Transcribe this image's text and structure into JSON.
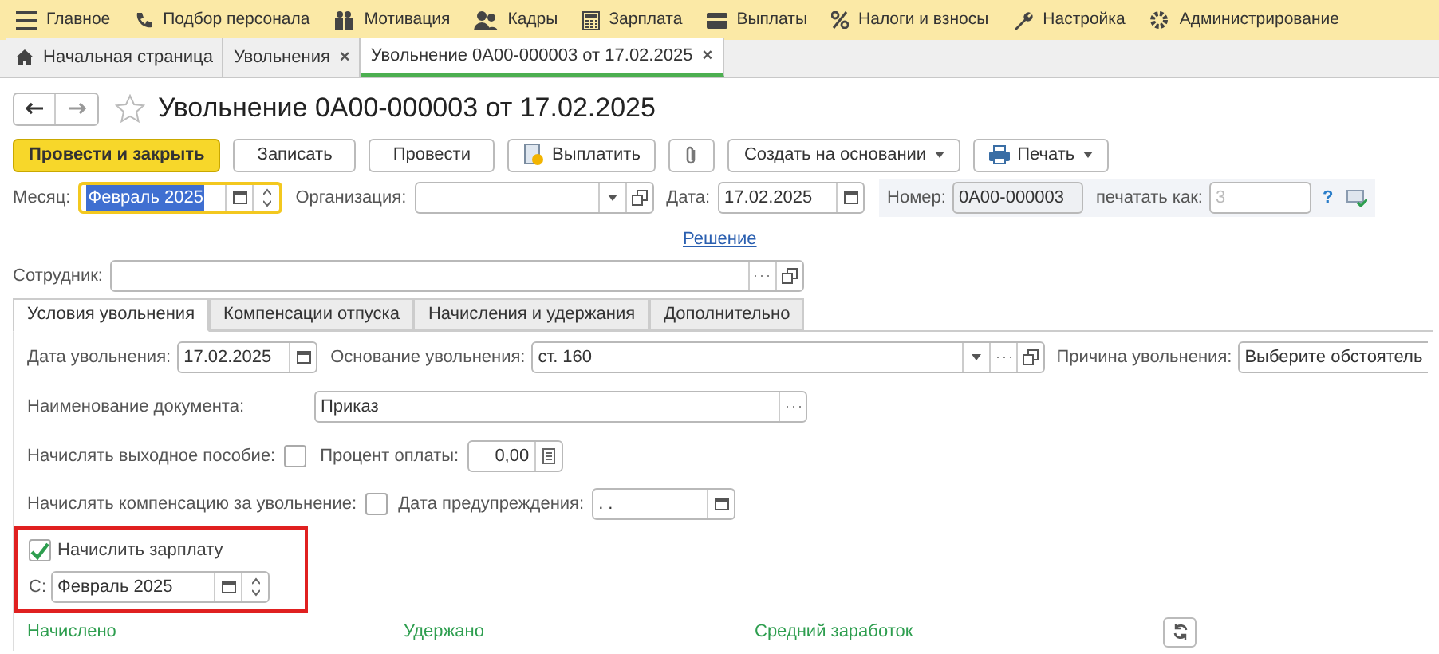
{
  "main_menu": [
    {
      "label": "Главное"
    },
    {
      "label": "Подбор персонала"
    },
    {
      "label": "Мотивация"
    },
    {
      "label": "Кадры"
    },
    {
      "label": "Зарплата"
    },
    {
      "label": "Выплаты"
    },
    {
      "label": "Налоги и взносы"
    },
    {
      "label": "Настройка"
    },
    {
      "label": "Администрирование"
    }
  ],
  "open_tabs": [
    {
      "label": "Начальная страница",
      "selected": false
    },
    {
      "label": "Увольнения",
      "selected": false,
      "close": "×"
    },
    {
      "label": "Увольнение 0A00-000003 от 17.02.2025",
      "selected": true,
      "close": "×"
    }
  ],
  "document": {
    "title": "Увольнение 0A00-000003 от 17.02.2025"
  },
  "toolbar": [
    {
      "kind": "primary",
      "label": "Провести и закрыть"
    },
    {
      "kind": "plain",
      "label": "Записать"
    },
    {
      "kind": "plain",
      "label": "Провести"
    },
    {
      "kind": "pay",
      "label": "Выплатить"
    },
    {
      "kind": "attach"
    },
    {
      "kind": "dropdown",
      "label": "Создать на основании"
    },
    {
      "kind": "print",
      "label": "Печать"
    }
  ],
  "header": {
    "month": {
      "label": "Месяц:",
      "value": "Февраль 2025",
      "focused": true
    },
    "organization": {
      "label": "Организация:"
    },
    "date": {
      "label": "Дата:",
      "value": "17.02.2025"
    },
    "number": {
      "label": "Номер:",
      "value": "0A00-000003"
    },
    "print_as": {
      "label": "печатать как:",
      "placeholder": "3"
    },
    "help": "?"
  },
  "decision_link": "Решение",
  "employee": {
    "label": "Сотрудник:"
  },
  "form_tabs": [
    {
      "label": "Условия увольнения",
      "selected": true
    },
    {
      "label": "Компенсации отпуска",
      "selected": false
    },
    {
      "label": "Начисления и удержания",
      "selected": false
    },
    {
      "label": "Дополнительно",
      "selected": false
    }
  ],
  "conditions": {
    "dismissal_date": {
      "label": "Дата увольнения:",
      "value": "17.02.2025"
    },
    "basis": {
      "label": "Основание увольнения:",
      "value": "ст. 160"
    },
    "reason": {
      "label": "Причина увольнения:",
      "value": "Выберите обстоятель"
    },
    "document_name": {
      "label": "Наименование документа:",
      "value": "Приказ"
    },
    "severance": {
      "label": "Начислять выходное пособие:",
      "checked": false
    },
    "pay_percent": {
      "label": "Процент оплаты:",
      "value": "0,00"
    },
    "compensation": {
      "label": "Начислять компенсацию за увольнение:",
      "checked": false
    },
    "notice_date": {
      "label": "Дата предупреждения:",
      "value": " .  ."
    },
    "accrue_salary": {
      "label": "Начислить зарплату",
      "checked": true
    },
    "from_month": {
      "label": "С:",
      "value": "Февраль 2025"
    }
  },
  "sections": [
    {
      "label": "Начислено"
    },
    {
      "label": "Удержано"
    },
    {
      "label": "Средний заработок"
    }
  ]
}
